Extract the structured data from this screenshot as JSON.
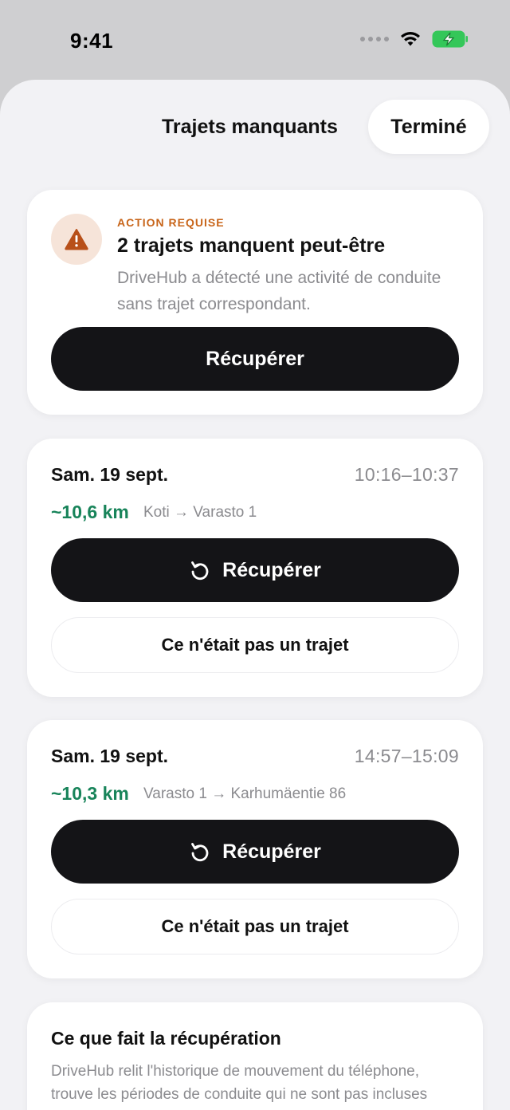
{
  "status_bar": {
    "time": "9:41"
  },
  "header": {
    "title": "Trajets manquants",
    "done_label": "Terminé"
  },
  "alert": {
    "eyebrow": "ACTION REQUISE",
    "title": "2 trajets manquent peut-être",
    "description": "DriveHub a détecté une activité de conduite sans trajet correspondant.",
    "button_label": "Récupérer"
  },
  "trips": [
    {
      "date": "Sam. 19 sept.",
      "time_range": "10:16–10:37",
      "distance": "~10,6 km",
      "route": "Koti → Varasto 1",
      "recover_label": "Récupérer",
      "dismiss_label": "Ce n'était pas un trajet"
    },
    {
      "date": "Sam. 19 sept.",
      "time_range": "14:57–15:09",
      "distance": "~10,3 km",
      "route": "Varasto 1 → Karhumäentie 86",
      "recover_label": "Récupérer",
      "dismiss_label": "Ce n'était pas un trajet"
    }
  ],
  "info": {
    "title": "Ce que fait la récupération",
    "text": "DriveHub relit l'historique de mouvement du téléphone, trouve les périodes de conduite qui ne sont pas incluses dans un trajet et les reconstruit."
  },
  "colors": {
    "accent_warning": "#c8651a",
    "distance_green": "#18845a",
    "primary_button": "#141417"
  },
  "icons": {
    "alert": "warning-triangle-icon",
    "recover": "rotate-ccw-icon",
    "wifi": "wifi-icon",
    "battery": "battery-charging-icon"
  }
}
